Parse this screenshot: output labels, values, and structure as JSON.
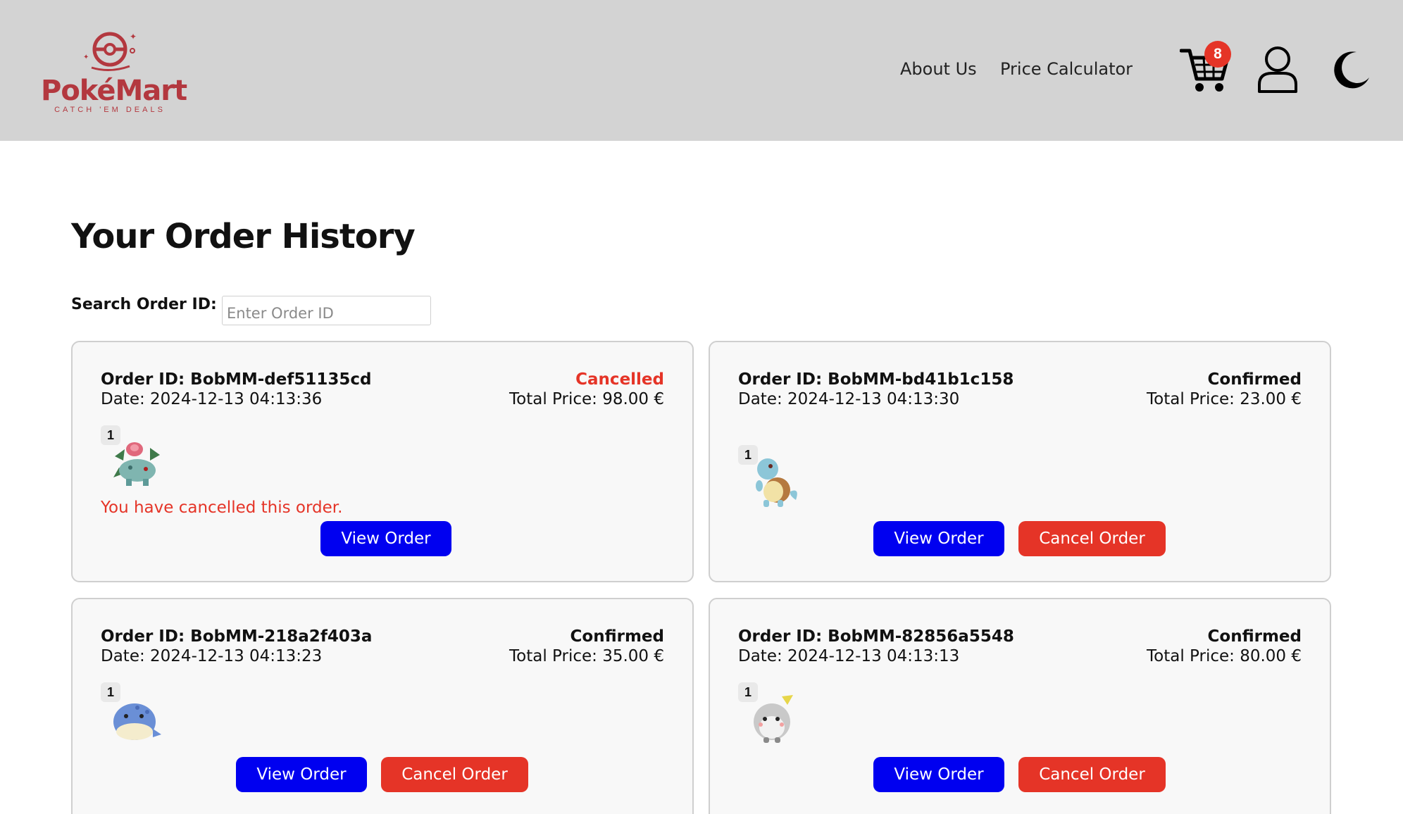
{
  "brand": {
    "name": "PokéMart",
    "tagline": "CATCH 'EM DEALS",
    "color": "#b3383f"
  },
  "nav": {
    "about": "About Us",
    "calculator": "Price Calculator"
  },
  "cart": {
    "count": "8"
  },
  "page": {
    "title": "Your Order History"
  },
  "search": {
    "label": "Search Order ID:",
    "placeholder": "Enter Order ID",
    "value": ""
  },
  "colors": {
    "header": "#d3d3d3",
    "view_button": "#0000f0",
    "cancel_button": "#e53427",
    "cancelled_text": "#e53427"
  },
  "orders": [
    {
      "id_label": "Order ID: BobMM-def51135cd",
      "date_label": "Date: 2024-12-13 04:13:36",
      "status": "Cancelled",
      "total_label": "Total Price: 98.00 €",
      "items": [
        {
          "qty": "1",
          "icon": "ivysaur-sprite-icon"
        }
      ],
      "note": "You have cancelled this order.",
      "view_label": "View Order"
    },
    {
      "id_label": "Order ID: BobMM-bd41b1c158",
      "date_label": "Date: 2024-12-13 04:13:30",
      "status": "Confirmed",
      "total_label": "Total Price: 23.00 €",
      "items": [
        {
          "qty": "1",
          "icon": "squirtle-sprite-icon"
        }
      ],
      "view_label": "View Order",
      "cancel_label": "Cancel Order"
    },
    {
      "id_label": "Order ID: BobMM-218a2f403a",
      "date_label": "Date: 2024-12-13 04:13:23",
      "status": "Confirmed",
      "total_label": "Total Price: 35.00 €",
      "items": [
        {
          "qty": "1",
          "icon": "spheal-sprite-icon"
        }
      ],
      "view_label": "View Order",
      "cancel_label": "Cancel Order"
    },
    {
      "id_label": "Order ID: BobMM-82856a5548",
      "date_label": "Date: 2024-12-13 04:13:13",
      "status": "Confirmed",
      "total_label": "Total Price: 80.00 €",
      "items": [
        {
          "qty": "1",
          "icon": "togedemaru-sprite-icon"
        }
      ],
      "view_label": "View Order",
      "cancel_label": "Cancel Order"
    }
  ]
}
